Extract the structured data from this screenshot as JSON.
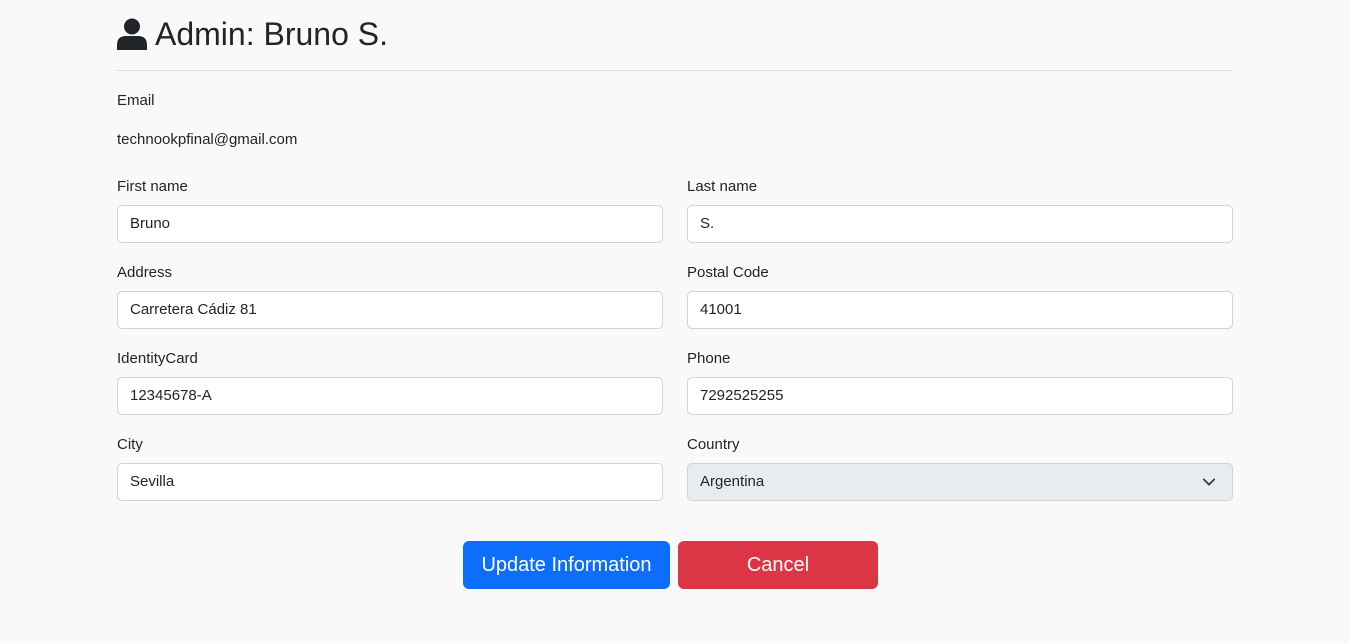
{
  "header": {
    "icon": "user-icon",
    "title": "Admin: Bruno S."
  },
  "email": {
    "label": "Email",
    "value": "technookpfinal@gmail.com"
  },
  "fields": {
    "first_name": {
      "label": "First name",
      "value": "Bruno"
    },
    "last_name": {
      "label": "Last name",
      "value": "S."
    },
    "address": {
      "label": "Address",
      "value": "Carretera Cádiz 81"
    },
    "postal_code": {
      "label": "Postal Code",
      "value": "41001"
    },
    "identity_card": {
      "label": "IdentityCard",
      "value": "12345678-A"
    },
    "phone": {
      "label": "Phone",
      "value": "7292525255"
    },
    "city": {
      "label": "City",
      "value": "Sevilla"
    },
    "country": {
      "label": "Country",
      "value": "Argentina",
      "icon": "chevron-down-icon"
    }
  },
  "actions": {
    "update_label": "Update Information",
    "cancel_label": "Cancel"
  },
  "colors": {
    "primary": "#0d6efd",
    "danger": "#dc3545",
    "background": "#f8f9f8",
    "select_bg": "#e9ecef"
  }
}
